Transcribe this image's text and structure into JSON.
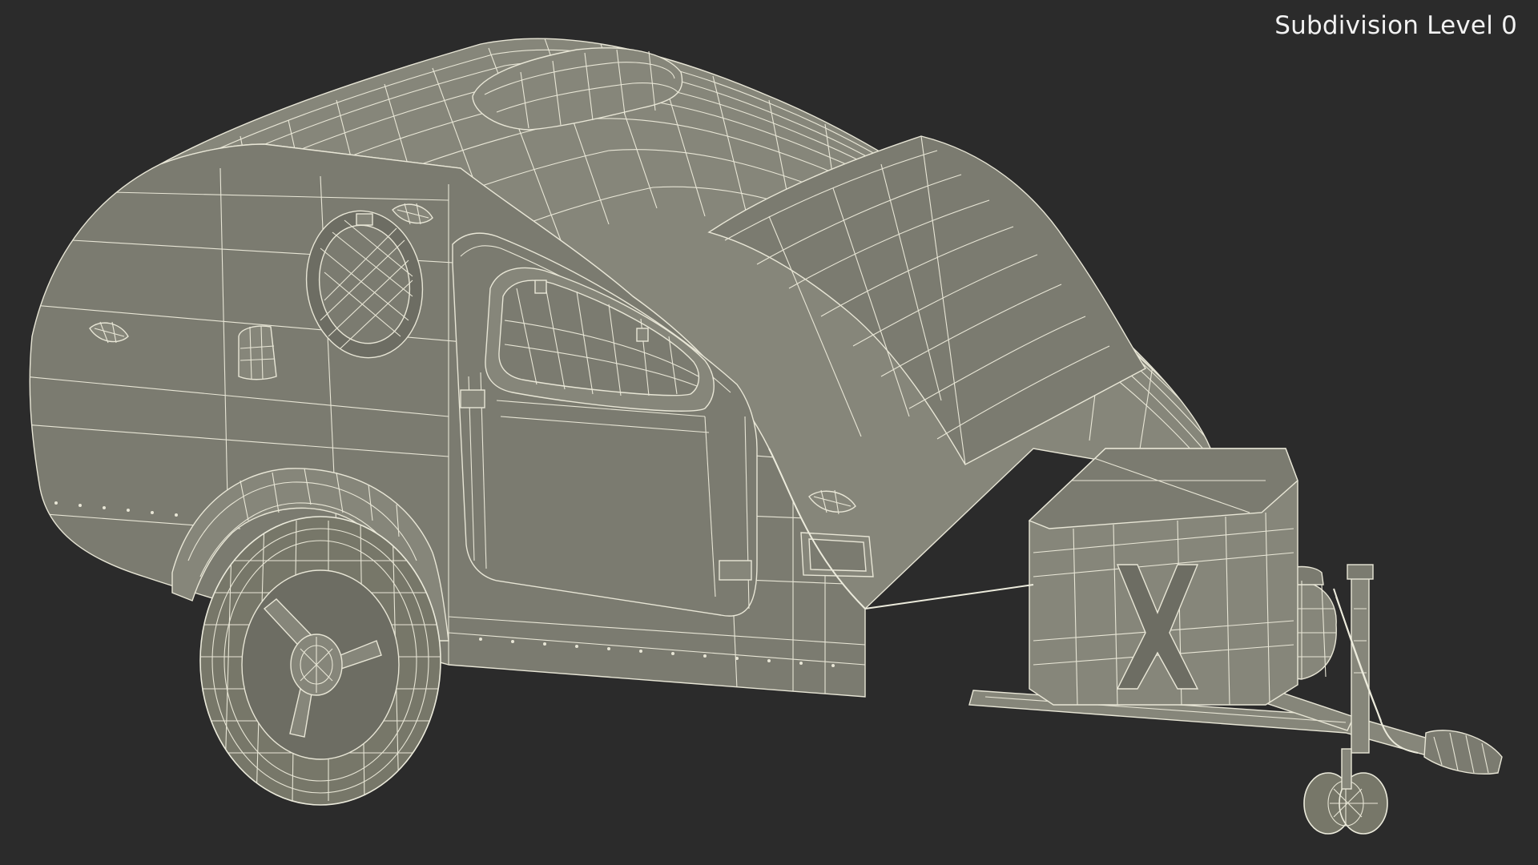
{
  "viewport": {
    "overlay_label": "Subdivision Level 0",
    "background_color": "#2b2b2b",
    "wire_color": "#e8e6d6",
    "surface_color": "#7b7b70"
  },
  "model": {
    "icon": "teardrop-trailer-wireframe"
  }
}
